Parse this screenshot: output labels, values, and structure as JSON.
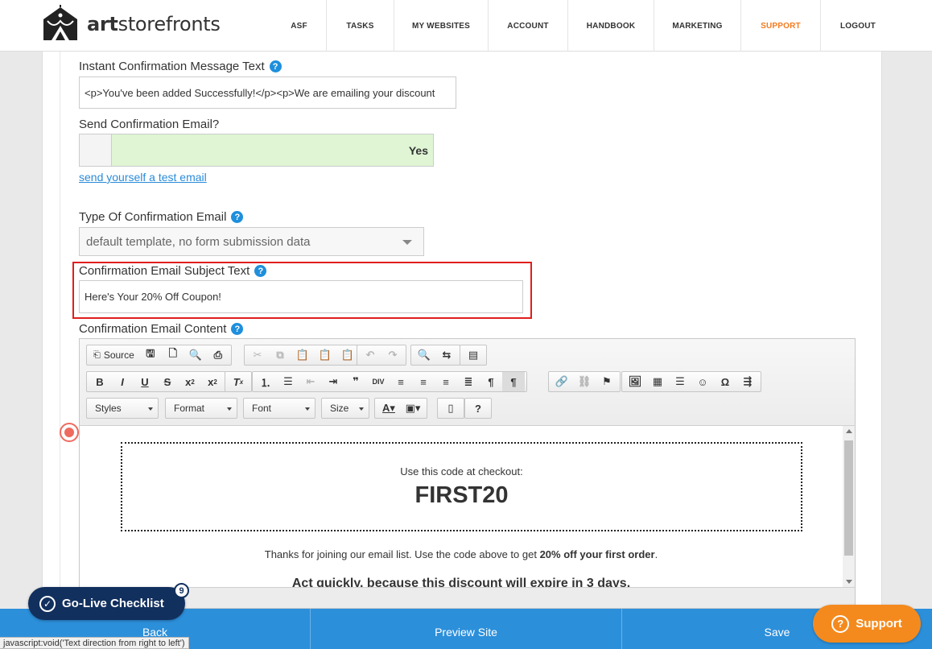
{
  "brand": {
    "name_bold": "art",
    "name_rest": "storefronts"
  },
  "nav": [
    {
      "label": "ASF",
      "width": 68
    },
    {
      "label": "TASKS",
      "width": 84
    },
    {
      "label": "MY WEBSITES",
      "width": 117
    },
    {
      "label": "ACCOUNT",
      "width": 99
    },
    {
      "label": "HANDBOOK",
      "width": 107
    },
    {
      "label": "MARKETING",
      "width": 108
    },
    {
      "label": "SUPPORT",
      "width": 99,
      "active": true
    },
    {
      "label": "LOGOUT",
      "width": 92
    }
  ],
  "form": {
    "instant_label": "Instant Confirmation Message Text",
    "instant_value": "<p>You've been added Successfully!</p><p>We are emailing your discount",
    "send_email_label": "Send Confirmation Email?",
    "send_email_value": "Yes",
    "test_email_link": "send yourself a test email",
    "type_label": "Type Of Confirmation Email",
    "type_value": "default template, no form submission data",
    "subject_label": "Confirmation Email Subject Text",
    "subject_value": "Here's Your 20% Off Coupon!",
    "content_label": "Confirmation Email Content",
    "help_glyph": "?"
  },
  "editor": {
    "source_label": "Source",
    "styles": "Styles",
    "format": "Format",
    "font": "Font",
    "size": "Size",
    "coupon_pre": "Use this code at checkout:",
    "coupon_code": "FIRST20",
    "thanks_pre": "Thanks for joining our email list.  Use the code above to get ",
    "thanks_bold": "20% off your first order",
    "thanks_post": ".",
    "urgent": "Act quickly, because this discount will expire in 3 days."
  },
  "bottom": {
    "back": "Back",
    "preview": "Preview Site",
    "save": "Save"
  },
  "checklist": {
    "label": "Go-Live Checklist",
    "count": "9"
  },
  "support_button": "Support",
  "statusbar": "javascript:void('Text direction from right to left')",
  "colors": {
    "accent_blue": "#2c8fda",
    "support_orange": "#f48a1e",
    "highlight_red": "#e01e1e",
    "nav_active": "#f47a20"
  }
}
